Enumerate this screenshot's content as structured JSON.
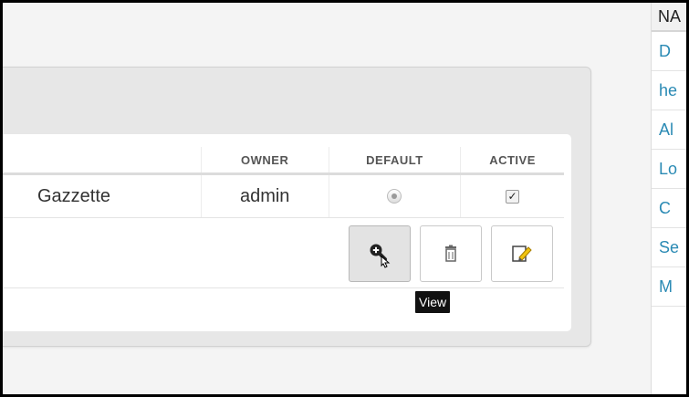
{
  "table": {
    "headers": {
      "owner": "OWNER",
      "default": "DEFAULT",
      "active": "ACTIVE"
    },
    "row": {
      "name": "Gazzette",
      "owner": "admin",
      "default_selected": true,
      "active_checked": true
    }
  },
  "actions": {
    "view_icon": "zoom-in-icon",
    "delete_icon": "trash-icon",
    "edit_icon": "edit-icon",
    "tooltip": "View"
  },
  "sidebar": {
    "header": "NA",
    "items": [
      "D",
      "he",
      "Al",
      "Lo",
      "C",
      "Se",
      "M"
    ]
  }
}
